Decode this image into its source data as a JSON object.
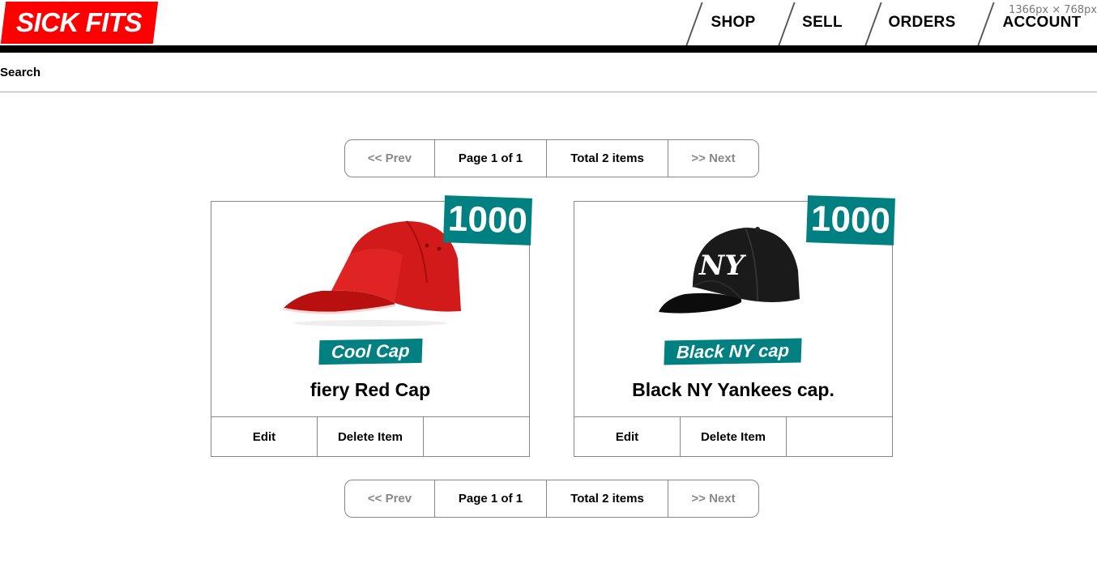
{
  "header": {
    "logo": "SICK FITS",
    "nav": [
      "SHOP",
      "SELL",
      "ORDERS",
      "ACCOUNT"
    ],
    "viewport_readout": "1366px × 768px"
  },
  "search": {
    "label": "Search",
    "value": ""
  },
  "pagination": {
    "prev": "<< Prev",
    "page": "Page 1 of 1",
    "total": "Total 2 items",
    "next": ">> Next"
  },
  "products": [
    {
      "price": "1000",
      "title": "Cool Cap",
      "description": "fiery Red Cap",
      "image": "red-cap",
      "edit": "Edit",
      "delete": "Delete Item"
    },
    {
      "price": "1000",
      "title": "Black NY cap",
      "description": "Black NY Yankees cap.",
      "image": "black-ny-cap",
      "edit": "Edit",
      "delete": "Delete Item"
    }
  ],
  "colors": {
    "brand_red": "#ff0000",
    "accent_teal": "#008080"
  }
}
